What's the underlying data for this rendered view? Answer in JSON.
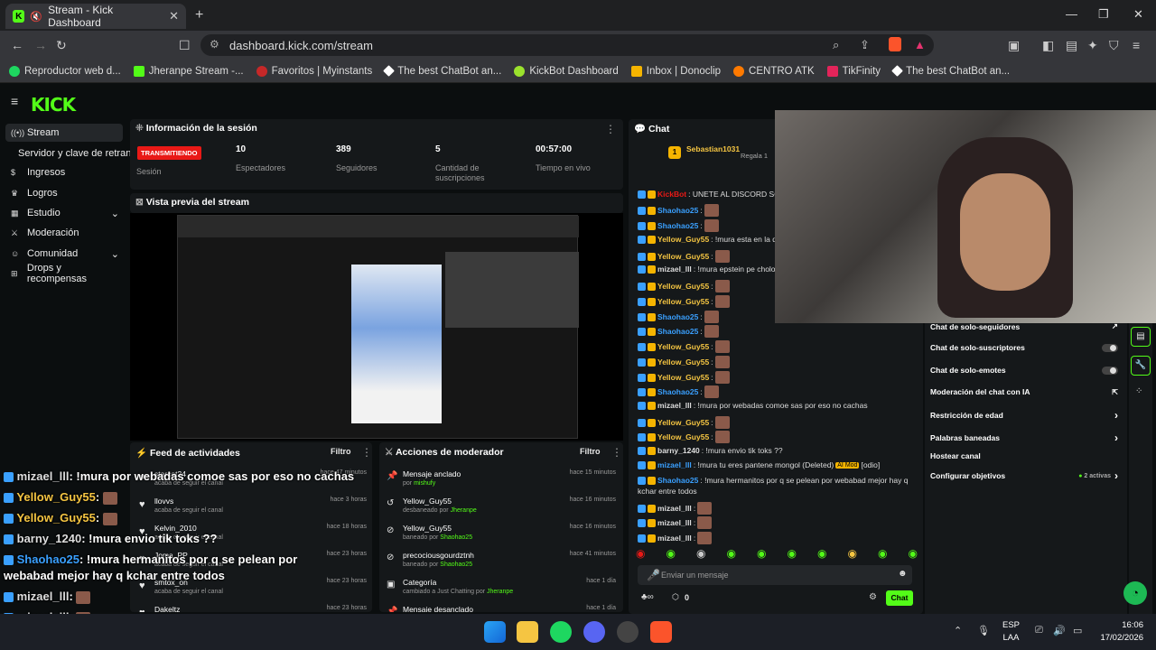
{
  "browser": {
    "tab_title": "Stream - Kick Dashboard",
    "url": "dashboard.kick.com/stream",
    "bookmarks": [
      "Reproductor web d...",
      "Jheranpe Stream -...",
      "Favoritos | Myinstants",
      "The best ChatBot an...",
      "KickBot Dashboard",
      "Inbox | Donoclip",
      "CENTRO ATK",
      "TikFinity",
      "The best ChatBot an..."
    ]
  },
  "sidebar": {
    "items": [
      "Stream",
      "Servidor y clave de retransm",
      "Ingresos",
      "Logros",
      "Estudio",
      "Moderación",
      "Comunidad",
      "Drops y recompensas"
    ]
  },
  "session": {
    "title": "Información de la sesión",
    "status": "TRANSMITIENDO",
    "status_label": "Sesión",
    "stats": [
      {
        "value": "10",
        "label": "Espectadores"
      },
      {
        "value": "389",
        "label": "Seguidores"
      },
      {
        "value": "5",
        "label": "Cantidad de suscripciones"
      },
      {
        "value": "00:57:00",
        "label": "Tiempo en vivo"
      }
    ]
  },
  "preview": {
    "title": "Vista previa del stream"
  },
  "feed": {
    "title": "Feed de actividades",
    "filter": "Filtro",
    "items": [
      {
        "name": "starcat24",
        "desc": "acaba de seguir el canal",
        "time": "hace 47 minutos"
      },
      {
        "name": "llovvs",
        "desc": "acaba de seguir el canal",
        "time": "hace 3 horas"
      },
      {
        "name": "Kelvin_2010",
        "desc": "acaba de seguir el canal",
        "time": "hace 18 horas"
      },
      {
        "name": "Joma_PP",
        "desc": "acaba de seguir el canal",
        "time": "hace 23 horas"
      },
      {
        "name": "smtox_on",
        "desc": "acaba de seguir el canal",
        "time": "hace 23 horas"
      },
      {
        "name": "Dakeltz",
        "desc": "",
        "time": "hace 23 horas"
      }
    ]
  },
  "mod": {
    "title": "Acciones de moderador",
    "filter": "Filtro",
    "items": [
      {
        "name": "Mensaje anclado",
        "sub": "por",
        "who": "mishufy",
        "time": "hace 15 minutos"
      },
      {
        "name": "Yellow_Guy55",
        "sub": "desbaneado por",
        "who": "Jheranpe",
        "time": "hace 16 minutos"
      },
      {
        "name": "Yellow_Guy55",
        "sub": "baneado por",
        "who": "Shaohao25",
        "time": "hace 16 minutos"
      },
      {
        "name": "precociousgourdztnh",
        "sub": "baneado por",
        "who": "Shaohao25",
        "time": "hace 41 minutos"
      },
      {
        "name": "Categoría",
        "sub": "cambiado a Just Chatting por",
        "who": "Jheranpe",
        "time": "hace 1 día"
      },
      {
        "name": "Mensaje desanclado",
        "sub": "",
        "who": "",
        "time": "hace 1 día"
      }
    ]
  },
  "chat": {
    "title": "Chat",
    "pinned_user": "Sebastian1031",
    "pinned_extra": "Regala 1",
    "lines": [
      {
        "u": "KickBot",
        "c": "#e91916",
        "t": ": UNETE AL DISCORD SOLI"
      },
      {
        "u": "Shaohao25",
        "c": "#3aa0ff",
        "t": ":"
      },
      {
        "u": "Shaohao25",
        "c": "#3aa0ff",
        "t": ":"
      },
      {
        "u": "Yellow_Guy55",
        "c": "#f5c542",
        "t": ": !mura esta en la depp web"
      },
      {
        "u": "Yellow_Guy55",
        "c": "#f5c542",
        "t": ":"
      },
      {
        "u": "mizael_lll",
        "c": "#ddd",
        "t": ": !mura epstein pe cholo"
      },
      {
        "u": "Yellow_Guy55",
        "c": "#f5c542",
        "t": ":"
      },
      {
        "u": "Yellow_Guy55",
        "c": "#f5c542",
        "t": ":"
      },
      {
        "u": "Shaohao25",
        "c": "#3aa0ff",
        "t": ":"
      },
      {
        "u": "Shaohao25",
        "c": "#3aa0ff",
        "t": ":"
      },
      {
        "u": "Yellow_Guy55",
        "c": "#f5c542",
        "t": ":"
      },
      {
        "u": "Yellow_Guy55",
        "c": "#f5c542",
        "t": ":"
      },
      {
        "u": "Yellow_Guy55",
        "c": "#f5c542",
        "t": ":"
      },
      {
        "u": "Shaohao25",
        "c": "#3aa0ff",
        "t": ":"
      },
      {
        "u": "mizael_lll",
        "c": "#ddd",
        "t": ": !mura por webadas comoe sas por eso no cachas"
      },
      {
        "u": "Yellow_Guy55",
        "c": "#f5c542",
        "t": ":"
      },
      {
        "u": "Yellow_Guy55",
        "c": "#f5c542",
        "t": ":"
      },
      {
        "u": "barny_1240",
        "c": "#ddd",
        "t": ": !mura envio tik toks ??"
      },
      {
        "u": "mizael_lll",
        "c": "#3aa0ff",
        "t": ": !mura tu eres pantene mongol (Deleted)"
      },
      {
        "u": "Shaohao25",
        "c": "#3aa0ff",
        "t": ": !mura hermanitos por q se pelean por webabad mejor hay q"
      },
      {
        "u": "",
        "c": "#ddd",
        "t": "kchar entre todos"
      },
      {
        "u": "mizael_lll",
        "c": "#ddd",
        "t": ":"
      },
      {
        "u": "mizael_lll",
        "c": "#ddd",
        "t": ":"
      },
      {
        "u": "mizael_lll",
        "c": "#ddd",
        "t": ":"
      }
    ],
    "ai_mod": "AI Mod",
    "odio": "[odio]",
    "input_placeholder": "Enviar un mensaje",
    "count": "0",
    "send": "Chat"
  },
  "settings": {
    "items": [
      "Chat de solo-seguidores",
      "Chat de solo-suscriptores",
      "Chat de solo-emotes",
      "Moderación del chat con IA",
      "Restricción de edad",
      "Palabras baneadas",
      "Hostear canal",
      "Configurar objetivos"
    ],
    "goals": "2 activas"
  },
  "overlay": [
    {
      "u": "mizael_lll",
      "c": "#ddd",
      "t": ": !mura por webadas comoe sas por eso no cachas"
    },
    {
      "u": "Yellow_Guy55",
      "c": "#f5c542",
      "t": ":"
    },
    {
      "u": "Yellow_Guy55",
      "c": "#f5c542",
      "t": ":"
    },
    {
      "u": "barny_1240",
      "c": "#ddd",
      "t": ": !mura envio tik toks ??"
    },
    {
      "u": "Shaohao25",
      "c": "#3aa0ff",
      "t": ": !mura hermanitos por q se pelean por"
    },
    {
      "u": "",
      "c": "#ddd",
      "t": "webabad mejor hay q kchar entre todos"
    },
    {
      "u": "mizael_lll",
      "c": "#ddd",
      "t": ":"
    },
    {
      "u": "mizael_lll",
      "c": "#ddd",
      "t": ":"
    },
    {
      "u": "mizael_lll",
      "c": "#ddd",
      "t": ":"
    }
  ],
  "taskbar": {
    "lang1": "ESP",
    "lang2": "LAA",
    "time": "16:06",
    "date": "17/02/2026"
  },
  "colors": {
    "kick_green": "#53fc18",
    "live_red": "#e91916"
  }
}
